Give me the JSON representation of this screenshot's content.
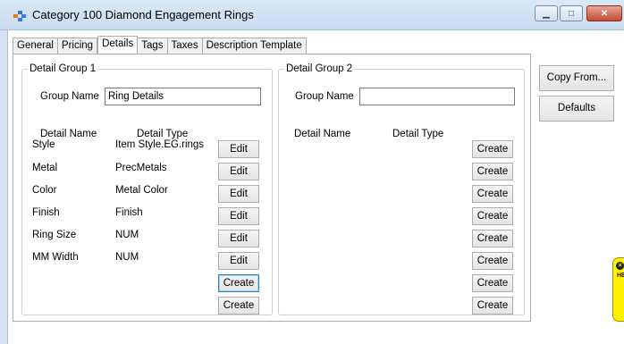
{
  "window": {
    "title": "Category 100 Diamond Engagement Rings",
    "minimize_glyph": "▁",
    "maximize_glyph": "□",
    "close_glyph": "✕"
  },
  "tabs": [
    "General",
    "Pricing",
    "Details",
    "Tags",
    "Taxes",
    "Description Template"
  ],
  "active_tab": "Details",
  "group1": {
    "title": "Detail Group 1",
    "group_name_label": "Group Name",
    "group_name_value": "Ring Details",
    "col_name": "Detail Name",
    "col_type": "Detail Type",
    "rows": [
      {
        "name": "Style",
        "type": "Item Style.EG.rings",
        "button": "Edit"
      },
      {
        "name": "Metal",
        "type": "PrecMetals",
        "button": "Edit"
      },
      {
        "name": "Color",
        "type": "Metal Color",
        "button": "Edit"
      },
      {
        "name": "Finish",
        "type": "Finish",
        "button": "Edit"
      },
      {
        "name": "Ring Size",
        "type": "NUM",
        "button": "Edit"
      },
      {
        "name": "MM Width",
        "type": "NUM",
        "button": "Edit"
      }
    ],
    "create_buttons": [
      "Create",
      "Create"
    ]
  },
  "group2": {
    "title": "Detail Group 2",
    "group_name_label": "Group Name",
    "group_name_value": "",
    "col_name": "Detail Name",
    "col_type": "Detail Type",
    "create_buttons": [
      "Create",
      "Create",
      "Create",
      "Create",
      "Create",
      "Create",
      "Create",
      "Create"
    ]
  },
  "side_buttons": {
    "copy_from": "Copy From...",
    "defaults": "Defaults"
  },
  "help_tab": {
    "text": "HELP"
  }
}
